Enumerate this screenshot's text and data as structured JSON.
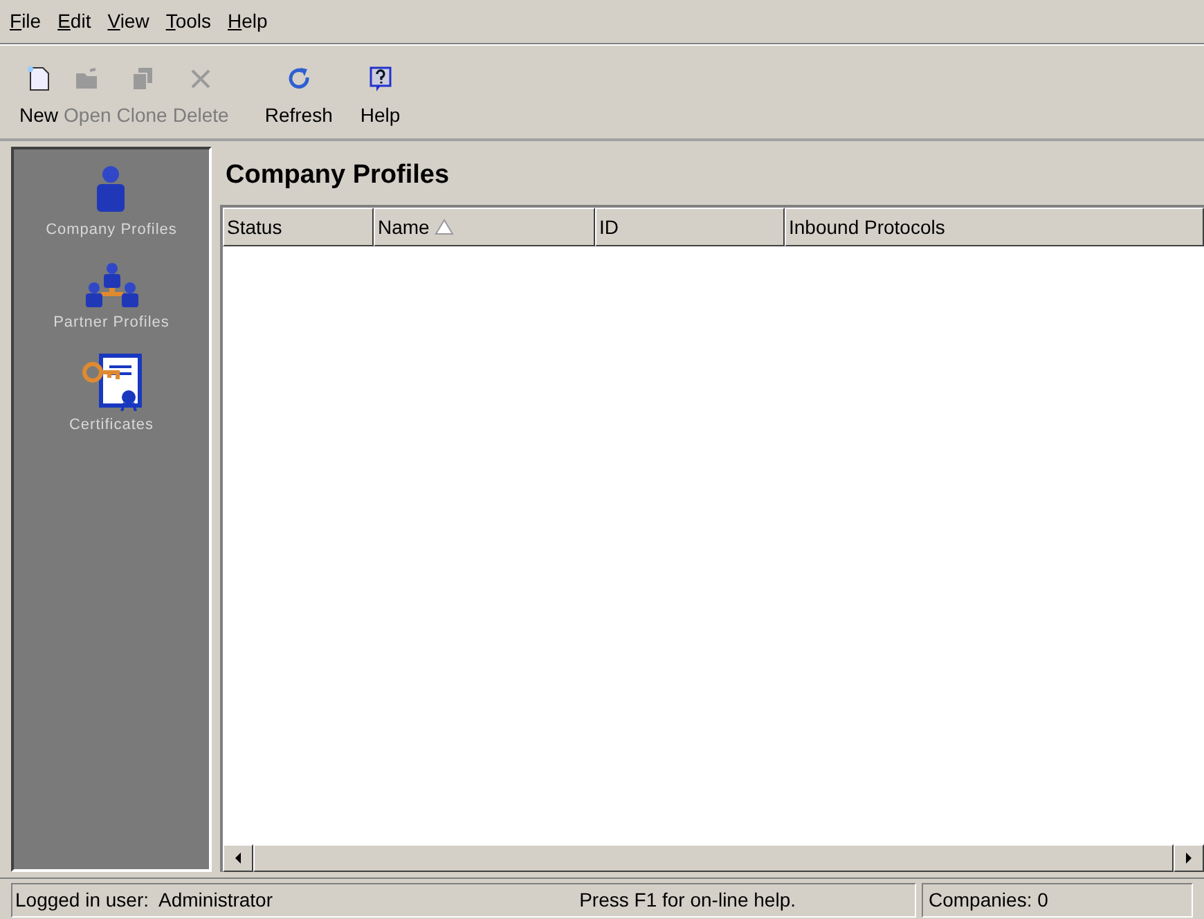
{
  "menu": [
    "File",
    "Edit",
    "View",
    "Tools",
    "Help"
  ],
  "toolbar": [
    {
      "kind": "new",
      "label": "New",
      "disabled": false
    },
    {
      "kind": "open",
      "label": "Open",
      "disabled": true
    },
    {
      "kind": "clone",
      "label": "Clone",
      "disabled": true
    },
    {
      "kind": "delete",
      "label": "Delete",
      "disabled": true
    },
    {
      "kind": "refresh",
      "label": "Refresh",
      "disabled": false
    },
    {
      "kind": "help",
      "label": "Help",
      "disabled": false
    }
  ],
  "sidebar": {
    "items": [
      {
        "kind": "person",
        "label": "Company Profiles"
      },
      {
        "kind": "group",
        "label": "Partner Profiles"
      },
      {
        "kind": "certificate",
        "label": "Certificates"
      }
    ]
  },
  "panel": {
    "title": "Company Profiles",
    "table": {
      "columns": [
        {
          "label": "Status",
          "sorted": false
        },
        {
          "label": "Name",
          "sorted": true
        },
        {
          "label": "ID",
          "sorted": false
        },
        {
          "label": "Inbound Protocols",
          "sorted": false
        }
      ]
    }
  },
  "status_bar": {
    "user": "Logged in user:  Administrator",
    "hint": "Press F1 for on-line help.",
    "count": "Companies: 0"
  }
}
